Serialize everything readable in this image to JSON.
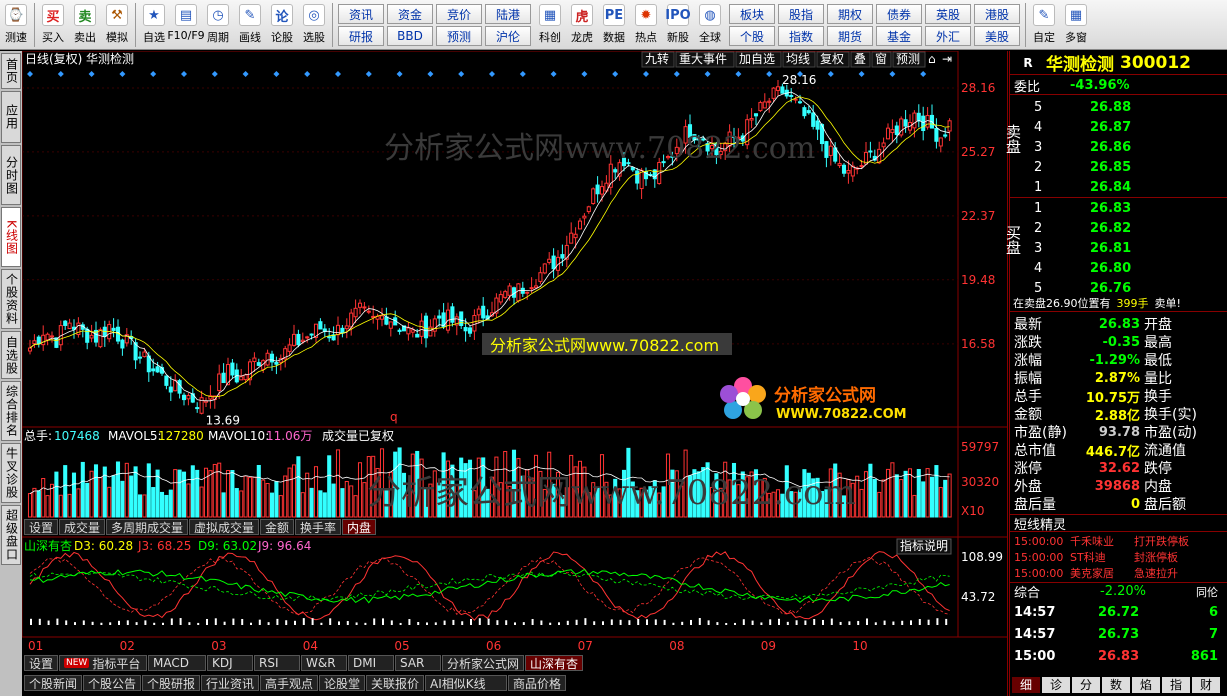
{
  "toolbar": {
    "left_buttons": [
      {
        "label": "测速",
        "icon": "speed-test-icon",
        "glyph": "⌚",
        "color": "#2266cc"
      },
      {
        "label": "买入",
        "icon": "buy-icon",
        "glyph": "买",
        "color": "#dd2222"
      },
      {
        "label": "卖出",
        "icon": "sell-icon",
        "glyph": "卖",
        "color": "#228822"
      },
      {
        "label": "模拟",
        "icon": "hammer-icon",
        "glyph": "⚒",
        "color": "#aa5500"
      },
      {
        "label": "自选",
        "icon": "star-icon",
        "glyph": "★",
        "color": "#2255bb"
      },
      {
        "label": "F10/F9",
        "icon": "f10-icon",
        "glyph": "▤",
        "color": "#2255bb"
      },
      {
        "label": "周期",
        "icon": "clock-icon",
        "glyph": "◷",
        "color": "#2255bb"
      },
      {
        "label": "画线",
        "icon": "pencil-icon",
        "glyph": "✎",
        "color": "#2255bb"
      },
      {
        "label": "论股",
        "icon": "discuss-icon",
        "glyph": "论",
        "color": "#2255bb"
      },
      {
        "label": "选股",
        "icon": "select-stock-icon",
        "glyph": "◎",
        "color": "#2255bb"
      }
    ],
    "grid1": [
      "资讯",
      "资金",
      "竞价",
      "陆港",
      "研报",
      "BBD",
      "预测",
      "沪伦"
    ],
    "mid_buttons": [
      {
        "label": "科创",
        "icon": "sci-tech-icon",
        "glyph": "▦",
        "color": "#2255bb"
      },
      {
        "label": "龙虎",
        "icon": "dragon-tiger-icon",
        "glyph": "虎",
        "color": "#cc2222"
      },
      {
        "label": "数据",
        "icon": "pe-data-icon",
        "glyph": "PE",
        "color": "#2255bb"
      },
      {
        "label": "热点",
        "icon": "hot-icon",
        "glyph": "✹",
        "color": "#dd3300"
      },
      {
        "label": "新股",
        "icon": "ipo-icon",
        "glyph": "IPO",
        "color": "#2255bb"
      },
      {
        "label": "全球",
        "icon": "globe-icon",
        "glyph": "◍",
        "color": "#2255bb"
      }
    ],
    "grid2": [
      "板块",
      "股指",
      "期权",
      "债券",
      "英股",
      "港股",
      "个股",
      "指数",
      "期货",
      "基金",
      "外汇",
      "美股"
    ],
    "right_buttons": [
      {
        "label": "自定",
        "icon": "custom-icon",
        "glyph": "✎",
        "color": "#2255bb"
      },
      {
        "label": "多窗",
        "icon": "multi-window-icon",
        "glyph": "▦",
        "color": "#2255bb"
      }
    ]
  },
  "side_tabs": [
    {
      "label": "首页",
      "active": false
    },
    {
      "label": "应用",
      "active": false
    },
    {
      "label": "分时图",
      "active": false
    },
    {
      "label": "K线图",
      "active": true
    },
    {
      "label": "个股资料",
      "active": false
    },
    {
      "label": "自选股",
      "active": false
    },
    {
      "label": "综合排名",
      "active": false
    },
    {
      "label": "牛叉诊股",
      "active": false
    },
    {
      "label": "超级盘口",
      "active": false
    }
  ],
  "chart_header": {
    "title": "日线(复权)",
    "stock": "华测检测",
    "buttons": [
      "九转",
      "重大事件",
      "加自选",
      "均线",
      "复权",
      "叠",
      "窗",
      "预测"
    ]
  },
  "chart_data": {
    "type": "candlestick",
    "price_axis_ticks": [
      28.16,
      25.27,
      22.37,
      19.48,
      16.58
    ],
    "price_range": [
      13.0,
      29.2
    ],
    "price_annotations": [
      {
        "label": "13.69",
        "value": 13.69,
        "position": "low"
      },
      {
        "label": "28.16",
        "value": 28.16,
        "position": "high"
      }
    ],
    "months": [
      "01",
      "02",
      "03",
      "04",
      "05",
      "06",
      "07",
      "08",
      "09",
      "10"
    ],
    "series": {
      "close_path": [
        16.4,
        17.2,
        16.8,
        17.6,
        17.1,
        16.9,
        17.4,
        16.8,
        16.2,
        15.6,
        15.1,
        14.5,
        14.2,
        13.9,
        14.6,
        15.3,
        15.0,
        15.8,
        16.2,
        16.0,
        16.6,
        16.9,
        17.3,
        17.0,
        17.6,
        18.0,
        17.6,
        17.9,
        17.4,
        17.0,
        17.3,
        17.8,
        17.6,
        17.2,
        17.8,
        18.3,
        18.8,
        19.0,
        19.5,
        19.9,
        20.5,
        21.6,
        22.6,
        23.7,
        24.6,
        25.0,
        24.3,
        24.0,
        24.6,
        25.6,
        26.3,
        26.0,
        25.2,
        25.8,
        26.1,
        26.9,
        27.6,
        28.0,
        27.4,
        26.6,
        25.7,
        24.8,
        24.2,
        24.7,
        25.3,
        25.9,
        26.6,
        27.0,
        26.5,
        26.0,
        26.8
      ],
      "candles_per_point": 3
    },
    "volume": {
      "total_label": "总手:",
      "total": "107468",
      "ma5_label": "MAVOL5:",
      "ma5": "127280",
      "ma10_label": "MAVOL10:",
      "ma10": "11.06万",
      "note": "成交量已复权",
      "ticks": [
        "59797",
        "30320",
        "X10"
      ]
    },
    "indicator": {
      "name": "山深有杏",
      "d3": "D3: 60.28",
      "j3": "J3: 68.25",
      "d9": "D9: 63.02",
      "j9": "J9: 96.64",
      "ticks": [
        "108.99",
        "43.72"
      ],
      "help": "指标说明"
    },
    "misc_labels": [
      "q"
    ]
  },
  "volume_tabs": [
    "设置",
    "成交量",
    "多周期成交量",
    "虚拟成交量",
    "金额",
    "换手率",
    "内盘"
  ],
  "volume_active": "内盘",
  "bottom_tabs": [
    "设置",
    "指标平台",
    "MACD",
    "KDJ",
    "RSI",
    "W&R",
    "DMI",
    "SAR",
    "分析家公式网",
    "山深有杏"
  ],
  "bottom_new_badge": "NEW",
  "bottom_active": "山深有杏",
  "bottom_tabs2": [
    "个股新闻",
    "个股公告",
    "个股研报",
    "行业资讯",
    "高手观点",
    "论股堂",
    "关联报价",
    "AI相似K线",
    "商品价格"
  ],
  "watermarks": {
    "top": "分析家公式网www.70822.com",
    "popup": "分析家公式网www.70822.com",
    "logo_cn": "分析家公式网",
    "logo_url": "WWW.70822.COM",
    "volume": "分析家公式网www.70822.com"
  },
  "quote": {
    "flag": "R",
    "name": "华测检测",
    "code": "300012",
    "wei_label": "委比",
    "wei_value": "-43.96%",
    "sell_label": "卖盘",
    "buy_label": "买盘",
    "sell": [
      [
        "5",
        "26.88"
      ],
      [
        "4",
        "26.87"
      ],
      [
        "3",
        "26.86"
      ],
      [
        "2",
        "26.85"
      ],
      [
        "1",
        "26.84"
      ]
    ],
    "buy": [
      [
        "1",
        "26.83"
      ],
      [
        "2",
        "26.82"
      ],
      [
        "3",
        "26.81"
      ],
      [
        "4",
        "26.80"
      ],
      [
        "5",
        "26.76"
      ]
    ],
    "notice": {
      "text": "在卖盘26.90位置有",
      "qty": "399手",
      "tail": "卖单!"
    },
    "stats": [
      {
        "l": "最新",
        "v": "26.83",
        "c": "#0f0",
        "r": "开盘"
      },
      {
        "l": "涨跌",
        "v": "-0.35",
        "c": "#0f0",
        "r": "最高"
      },
      {
        "l": "涨幅",
        "v": "-1.29%",
        "c": "#0f0",
        "r": "最低"
      },
      {
        "l": "振幅",
        "v": "2.87%",
        "c": "#ff0",
        "r": "量比"
      },
      {
        "l": "总手",
        "v": "10.75万",
        "c": "#ff0",
        "r": "换手"
      },
      {
        "l": "金额",
        "v": "2.88亿",
        "c": "#ff0",
        "r": "换手(实)"
      },
      {
        "l": "市盈(静)",
        "v": "93.78",
        "c": "#ccc",
        "r": "市盈(动)"
      },
      {
        "l": "总市值",
        "v": "446.7亿",
        "c": "#ff0",
        "r": "流通值"
      },
      {
        "l": "涨停",
        "v": "32.62",
        "c": "#f33",
        "r": "跌停"
      },
      {
        "l": "外盘",
        "v": "39868",
        "c": "#f33",
        "r": "内盘"
      },
      {
        "l": "盘后量",
        "v": "0",
        "c": "#ff0",
        "r": "盘后额"
      }
    ],
    "spirit_title": "短线精灵",
    "spirit": [
      [
        "15:00:00",
        "千禾味业",
        "打开跌停板"
      ],
      [
        "15:00:00",
        "ST科迪",
        "封涨停板"
      ],
      [
        "15:00:00",
        "美克家居",
        "急速拉升"
      ]
    ],
    "summary_label": "综合",
    "summary_value": "-2.20%",
    "summary_right": "同伦",
    "ticks": [
      [
        "14:57",
        "26.72",
        "6"
      ],
      [
        "14:57",
        "26.73",
        "7"
      ],
      [
        "15:00",
        "26.83",
        "861"
      ]
    ],
    "tabs": [
      "细",
      "诊",
      "分",
      "数",
      "焰",
      "指",
      "财"
    ]
  },
  "colors": {
    "up": "#ff3333",
    "down": "#33ffff",
    "ma_white": "#ffffff",
    "ma_yellow": "#ffff00",
    "axis_red": "#880000"
  }
}
